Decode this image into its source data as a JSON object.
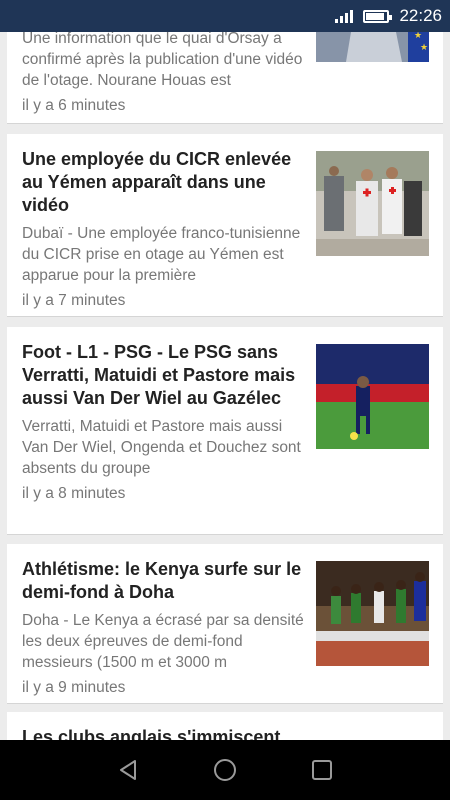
{
  "status_bar": {
    "time": "22:26",
    "battery_level": 0.8
  },
  "articles": [
    {
      "title": "",
      "summary": "Une information que le quai d'Orsay a confirmé après la publication d'une vidéo de l'otage. Nourane Houas est",
      "time_ago": "il y a 6 minutes",
      "thumbnail_icon": "portrait-thumbnail"
    },
    {
      "title": "Une employée du CICR enlevée au Yémen apparaît dans une vidéo",
      "summary": "Dubaï - Une employée franco-tunisienne du CICR prise en otage au Yémen est apparue pour la première",
      "time_ago": "il y a 7 minutes",
      "thumbnail_icon": "red-cross-workers-thumbnail"
    },
    {
      "title": "Foot - L1 - PSG - Le PSG sans Verratti, Matuidi et Pastore mais aussi Van Der Wiel au Gazélec",
      "summary": "Verratti, Matuidi et Pastore mais aussi Van Der Wiel, Ongenda et Douchez sont absents du groupe",
      "time_ago": "il y a 8 minutes",
      "thumbnail_icon": "football-player-thumbnail"
    },
    {
      "title": "Athlétisme: le Kenya surfe sur le demi-fond à Doha",
      "summary": "Doha - Le Kenya a écrasé par sa densité les deux épreuves de demi-fond messieurs (1500 m et 3000 m",
      "time_ago": "il y a 9 minutes",
      "thumbnail_icon": "runners-thumbnail"
    },
    {
      "title": "Les clubs anglais s'immiscent"
    }
  ],
  "nav": {
    "back": "back-icon",
    "home": "home-icon",
    "recents": "recents-icon"
  }
}
